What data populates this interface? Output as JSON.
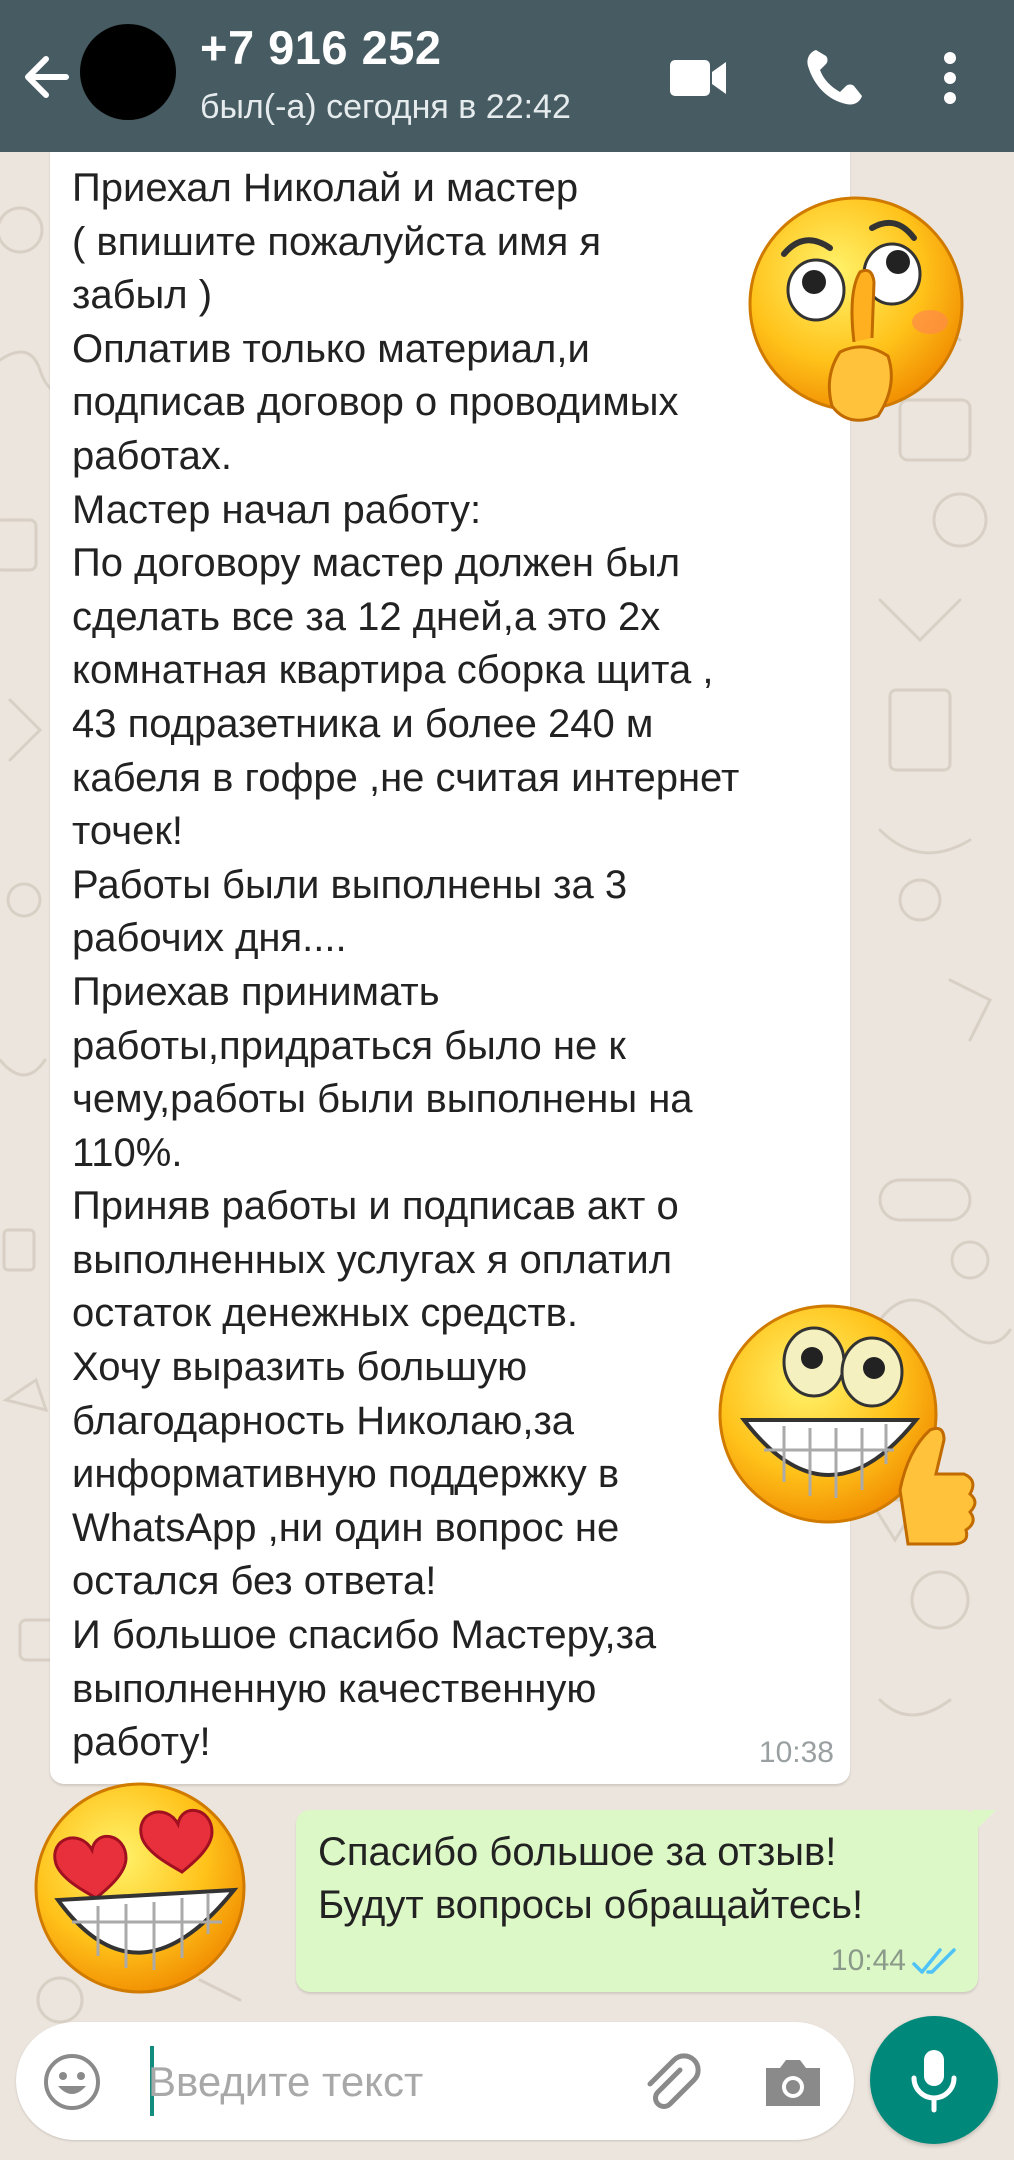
{
  "header": {
    "contact_name": "+7 916 252",
    "status": "был(-а) сегодня в 22:42",
    "icons": [
      "back-arrow-icon",
      "video-call-icon",
      "phone-call-icon",
      "more-vert-icon"
    ]
  },
  "messages": [
    {
      "direction": "incoming",
      "text": "Приехал Николай и мастер\n( впишите пожалуйста имя я\nзабыл )\nОплатив только материал,и\nподписав договор о проводимых\nработах.\nМастер начал работу:\nПо договору мастер должен был\nсделать все за 12 дней,а это 2х\nкомнатная квартира сборка щита ,\n43 подразетника и более 240 м\nкабеля в гофре ,не считая интернет\nточек!\nРаботы были выполнены за 3\nрабочих дня....\nПриехав принимать\nработы,придраться было не к\nчему,работы были выполнены на\n110%.\nПриняв работы и подписав акт о\nвыполненных услугах я оплатил\nостаток денежных средств.\nХочу выразить большую\nблагодарность Николаю,за\nинформативную поддержку в\nWhatsApp ,ни один вопрос не\nостался без ответа!\nИ большое спасибо Мастеру,за\nвыполненную качественную\nработу!",
      "time": "10:38"
    },
    {
      "direction": "outgoing",
      "text": "Спасибо большое за отзыв!\nБудут вопросы обращайтесь!",
      "time": "10:44",
      "status": "read"
    }
  ],
  "stickers": [
    "shush-emoji",
    "grin-thumbsup-emoji",
    "heart-eyes-emoji"
  ],
  "composer": {
    "placeholder": "Введите текст",
    "icons": [
      "emoji-icon",
      "attach-icon",
      "camera-icon",
      "mic-icon"
    ]
  },
  "colors": {
    "header_bg": "#465b62",
    "chat_bg": "#ece5dd",
    "outgoing_bubble": "#dcf8c6",
    "incoming_bubble": "#ffffff",
    "accent": "#00897b",
    "read_ticks": "#4fc3f7"
  }
}
